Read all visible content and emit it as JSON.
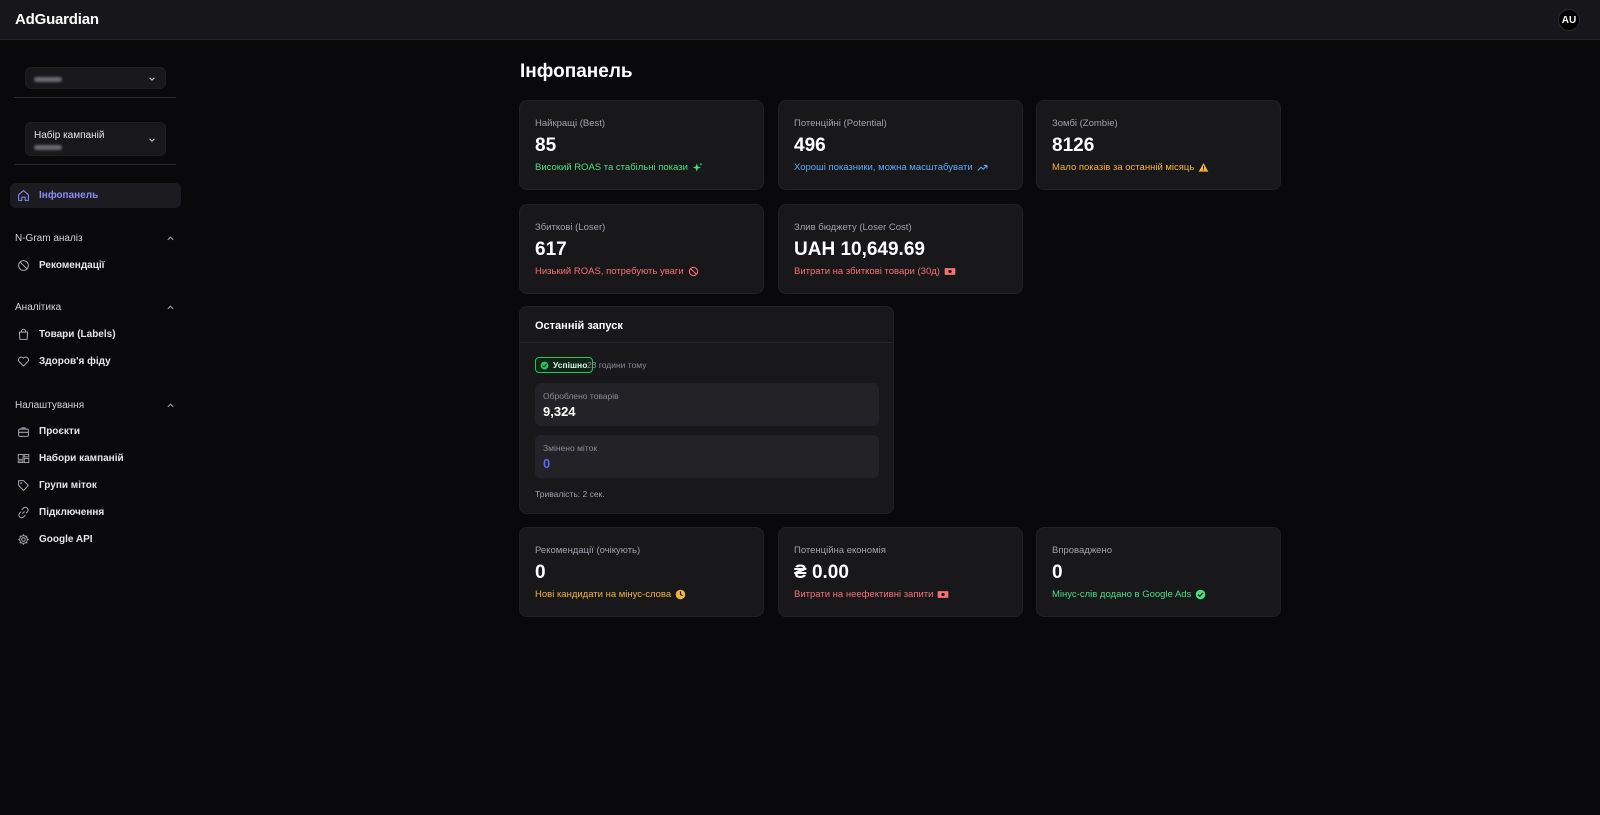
{
  "app": {
    "brand": "AdGuardian",
    "avatar_initials": "AU"
  },
  "sidebar": {
    "campaign_set_label": "Набір кампаній",
    "items": [
      {
        "label": "Інфопанель",
        "icon": "home-icon",
        "active": true
      },
      {
        "label": "Рекомендації",
        "icon": "ban-icon"
      },
      {
        "label": "Товари (Labels)",
        "icon": "shopping-bag-icon"
      },
      {
        "label": "Здоров'я фіду",
        "icon": "heart-icon"
      },
      {
        "label": "Проєкти",
        "icon": "briefcase-icon"
      },
      {
        "label": "Набори кампаній",
        "icon": "layers-icon"
      },
      {
        "label": "Групи міток",
        "icon": "tag-icon"
      },
      {
        "label": "Підключення",
        "icon": "link-icon"
      },
      {
        "label": "Google API",
        "icon": "gear-icon"
      }
    ],
    "sections": [
      {
        "label": "N-Gram аналіз"
      },
      {
        "label": "Аналітика"
      },
      {
        "label": "Налаштування"
      }
    ]
  },
  "main": {
    "title": "Інфопанель",
    "cards": [
      {
        "title": "Найкращі (Best)",
        "value": "85",
        "subtitle": "Високий ROAS та стабільні покази",
        "color": "#4ade80",
        "icon": "sparkles-icon"
      },
      {
        "title": "Потенційні (Potential)",
        "value": "496",
        "subtitle": "Хороші показники, можна масштабувати",
        "color": "#60a5fa",
        "icon": "trending-up-icon"
      },
      {
        "title": "Зомбі (Zombie)",
        "value": "8126",
        "subtitle": "Мало показів за останній місяць",
        "color": "#f5b13d",
        "icon": "warning-icon"
      },
      {
        "title": "Збиткові (Loser)",
        "value": "617",
        "subtitle": "Низький ROAS, потребують уваги",
        "color": "#f87171",
        "icon": "ban-icon"
      },
      {
        "title": "Злив бюджету (Loser Cost)",
        "value": "UAH 10,649.69",
        "subtitle": "Витрати на збиткові товари (30д)",
        "color": "#f87171",
        "icon": "money-icon"
      },
      {
        "title": "Рекомендації (очікують)",
        "value": "0",
        "subtitle": "Нові кандидати на мінус-слова",
        "color": "#f5b13d",
        "icon": "clock-icon"
      },
      {
        "title": "Потенційна економія",
        "value": "₴ 0.00",
        "subtitle": "Витрати на неефективні запити",
        "color": "#f87171",
        "icon": "money-icon"
      },
      {
        "title": "Впроваджено",
        "value": "0",
        "subtitle": "Мінус-слів додано в Google Ads",
        "color": "#4ade80",
        "icon": "check-circle-icon"
      }
    ],
    "last_run": {
      "title": "Останній запуск",
      "status": "Успішно",
      "ago": "23 години тому",
      "processed_label": "Оброблено товарів",
      "processed_value": "9,324",
      "changed_label": "Змінено міток",
      "changed_value": "0",
      "duration": "Тривалість: 2 сек."
    }
  }
}
